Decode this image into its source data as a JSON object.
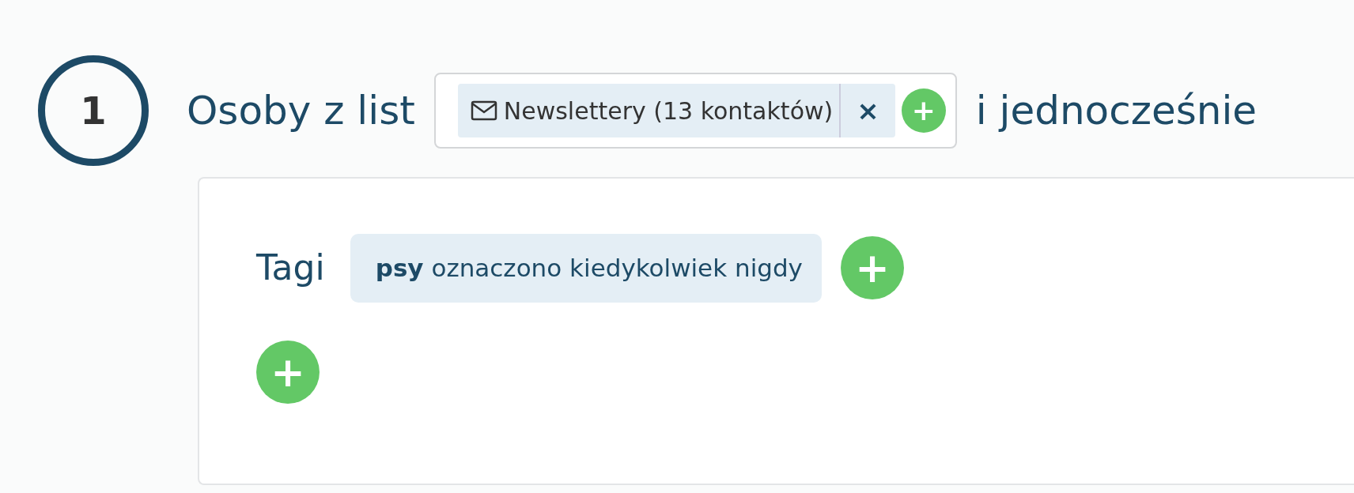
{
  "step": {
    "number": "1",
    "label": "Osoby z list",
    "suffix": "i jednocześnie"
  },
  "lists": [
    {
      "label": "Newslettery (13 kontaktów)",
      "remove": "×"
    }
  ],
  "list_add": "+",
  "conditions": [
    {
      "label": "Tagi",
      "tags": [
        {
          "name": "psy",
          "text": "oznaczono kiedykolwiek nigdy"
        }
      ],
      "add": "+"
    }
  ],
  "add_condition": "+"
}
